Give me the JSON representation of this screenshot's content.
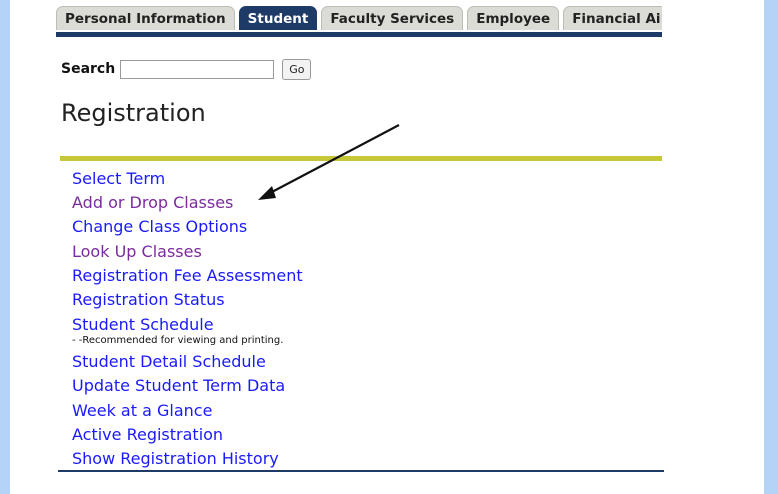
{
  "tabs": [
    {
      "label": "Personal Information",
      "active": false
    },
    {
      "label": "Student",
      "active": true
    },
    {
      "label": "Faculty Services",
      "active": false
    },
    {
      "label": "Employee",
      "active": false
    },
    {
      "label": "Financial Ai",
      "active": false
    }
  ],
  "search": {
    "label": "Search",
    "value": "",
    "button_label": "Go"
  },
  "page_title": "Registration",
  "menu_items": [
    {
      "label": "Select Term",
      "visited": false
    },
    {
      "label": "Add or Drop Classes",
      "visited": true
    },
    {
      "label": "Change Class Options",
      "visited": false
    },
    {
      "label": "Look Up Classes",
      "visited": true
    },
    {
      "label": "Registration Fee Assessment",
      "visited": false
    },
    {
      "label": "Registration Status",
      "visited": false
    },
    {
      "label": "Student Schedule",
      "visited": false,
      "note": "- -Recommended for viewing and printing."
    },
    {
      "label": "Student Detail Schedule",
      "visited": false
    },
    {
      "label": "Update Student Term Data",
      "visited": false
    },
    {
      "label": "Week at a Glance",
      "visited": false
    },
    {
      "label": "Active Registration",
      "visited": false
    },
    {
      "label": "Show Registration History",
      "visited": false
    }
  ],
  "colors": {
    "nav_blue": "#1e3a67",
    "link_blue": "#1a1aff",
    "link_visited": "#7b2b9e",
    "olive_rule": "#c7c73a",
    "side_background": "#b5d3f7"
  }
}
